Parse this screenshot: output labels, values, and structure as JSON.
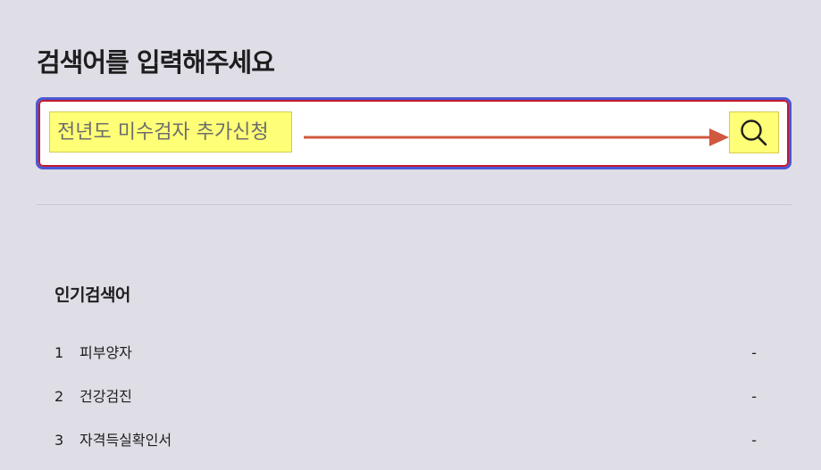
{
  "header": {
    "title": "검색어를 입력해주세요"
  },
  "search": {
    "placeholder": "전년도 미수검자 추가신청",
    "value": "",
    "button_icon": "search-icon",
    "colors": {
      "outer_border": "#4a58d6",
      "inner_border": "#c4182f",
      "highlight": "#ffff77",
      "arrow": "#d0583f"
    }
  },
  "popular": {
    "title": "인기검색어",
    "items": [
      {
        "rank": "1",
        "keyword": "피부양자",
        "trend": "-"
      },
      {
        "rank": "2",
        "keyword": "건강검진",
        "trend": "-"
      },
      {
        "rank": "3",
        "keyword": "자격득실확인서",
        "trend": "-"
      }
    ]
  }
}
